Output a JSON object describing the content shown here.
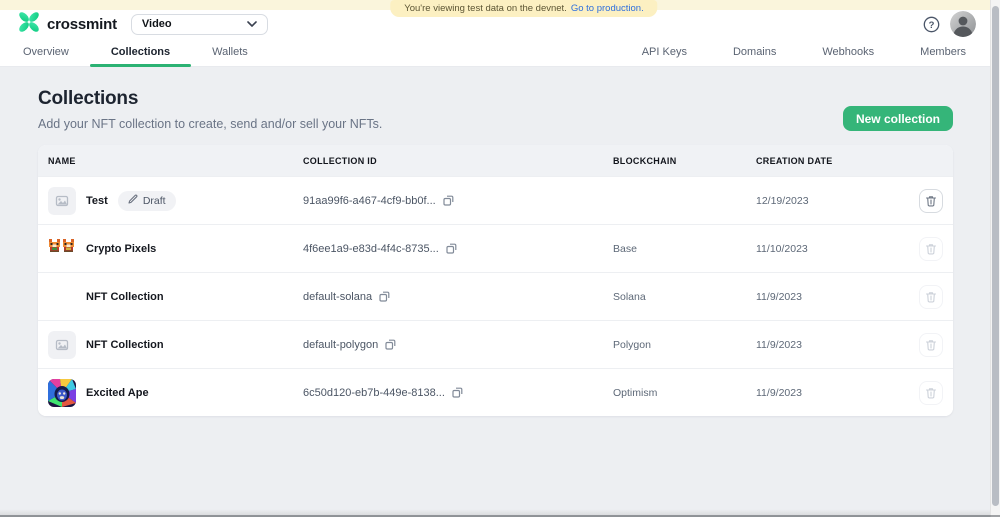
{
  "banner": {
    "message": "You're viewing test data on the devnet.",
    "link_label": "Go to production."
  },
  "header": {
    "brand": "crossmint",
    "project_dropdown": {
      "value": "Video"
    },
    "help_glyph": "?"
  },
  "nav": {
    "left": [
      {
        "label": "Overview",
        "active": false
      },
      {
        "label": "Collections",
        "active": true
      },
      {
        "label": "Wallets",
        "active": false
      }
    ],
    "right": [
      {
        "label": "API Keys"
      },
      {
        "label": "Domains"
      },
      {
        "label": "Webhooks"
      },
      {
        "label": "Members"
      }
    ]
  },
  "page": {
    "title": "Collections",
    "subtitle": "Add your NFT collection to create, send and/or sell your NFTs.",
    "primary_action": "New collection"
  },
  "table": {
    "columns": [
      "NAME",
      "COLLECTION ID",
      "BLOCKCHAIN",
      "CREATION DATE"
    ],
    "rows": [
      {
        "name": "Test",
        "badge": "Draft",
        "collection_id": "91aa99f6-a467-4cf9-bb0f...",
        "blockchain": "",
        "creation_date": "12/19/2023",
        "thumb": "image-placeholder",
        "deletable": true
      },
      {
        "name": "Crypto Pixels",
        "badge": null,
        "collection_id": "4f6ee1a9-e83d-4f4c-8735...",
        "blockchain": "Base",
        "creation_date": "11/10/2023",
        "thumb": "pixel-foxes",
        "deletable": false
      },
      {
        "name": "NFT Collection",
        "badge": null,
        "collection_id": "default-solana",
        "blockchain": "Solana",
        "creation_date": "11/9/2023",
        "thumb": "crossmint-logo",
        "deletable": false
      },
      {
        "name": "NFT Collection",
        "badge": null,
        "collection_id": "default-polygon",
        "blockchain": "Polygon",
        "creation_date": "11/9/2023",
        "thumb": "image-placeholder",
        "deletable": false
      },
      {
        "name": "Excited Ape",
        "badge": null,
        "collection_id": "6c50d120-eb7b-449e-8138...",
        "blockchain": "Optimism",
        "creation_date": "11/9/2023",
        "thumb": "excited-ape",
        "deletable": false
      }
    ]
  },
  "colors": {
    "accent_green": "#2bb273",
    "button_green": "#35b579",
    "banner_strip": "#faf5dc",
    "banner_pill": "#fcf0c2",
    "link_blue": "#2e6fdd",
    "page_background": "#edeff2"
  }
}
